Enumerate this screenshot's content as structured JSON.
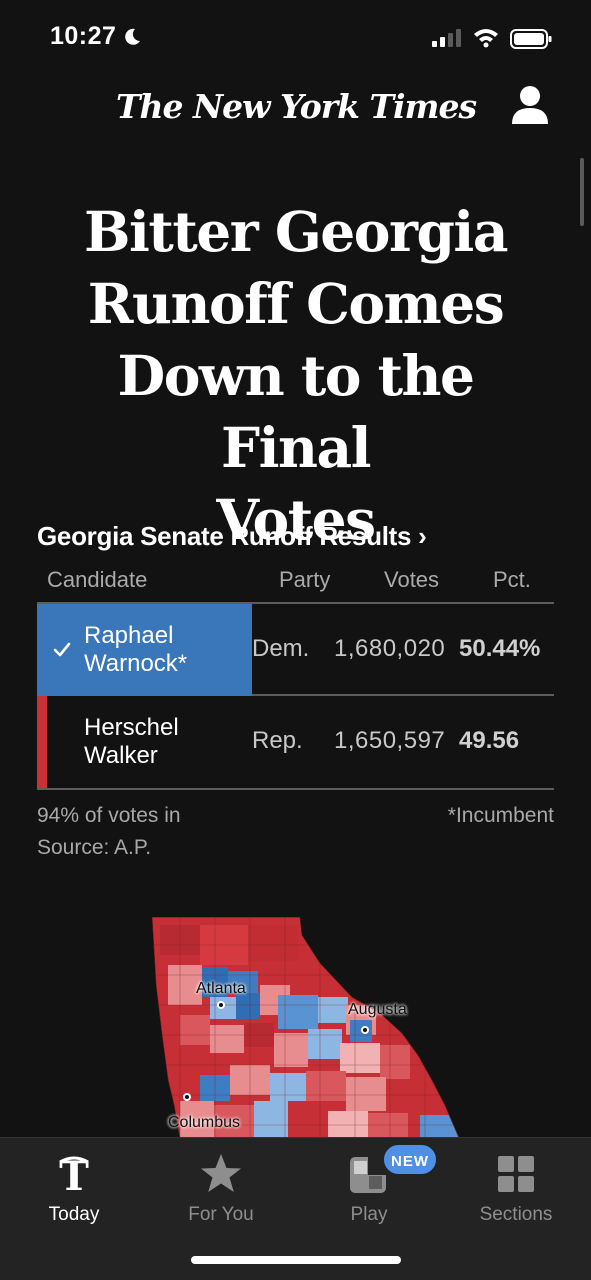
{
  "status_bar": {
    "time": "10:27",
    "icons": [
      "moon-icon",
      "signal-icon",
      "wifi-icon",
      "battery-icon"
    ]
  },
  "header": {
    "masthead": "The New York Times",
    "profile_icon": "person-icon"
  },
  "article": {
    "headline_lines": [
      "Bitter Georgia",
      "Runoff Comes",
      "Down to the Final",
      "Votes"
    ]
  },
  "results": {
    "title": "Georgia Senate Runoff Results ›",
    "columns": {
      "candidate": "Candidate",
      "party": "Party",
      "votes": "Votes",
      "pct": "Pct."
    },
    "rows": [
      {
        "name_lines": [
          "Raphael",
          "Warnock*"
        ],
        "party": "Dem.",
        "votes": "1,680,020",
        "pct": "50.44%",
        "winner": true,
        "color": "#3a76ba"
      },
      {
        "name_lines": [
          "Herschel",
          "Walker"
        ],
        "party": "Rep.",
        "votes": "1,650,597",
        "pct": "49.56",
        "winner": false,
        "color": "#c93135"
      }
    ],
    "reporting": "94% of votes in",
    "source": "Source: A.P.",
    "footnote": "*Incumbent"
  },
  "map": {
    "cities": [
      "Atlanta",
      "Augusta",
      "Columbus"
    ],
    "colors": {
      "dem_strong": "#2f6db5",
      "dem_light": "#8db6e2",
      "rep_strong": "#c62f35",
      "rep_light": "#e88d8f"
    }
  },
  "tab_bar": {
    "tabs": [
      {
        "label": "Today",
        "icon": "nyt-logo-icon",
        "active": true
      },
      {
        "label": "For You",
        "icon": "star-icon",
        "active": false
      },
      {
        "label": "Play",
        "icon": "games-icon",
        "active": false
      },
      {
        "label": "Sections",
        "icon": "grid-icon",
        "active": false
      }
    ],
    "new_badge": "NEW"
  }
}
